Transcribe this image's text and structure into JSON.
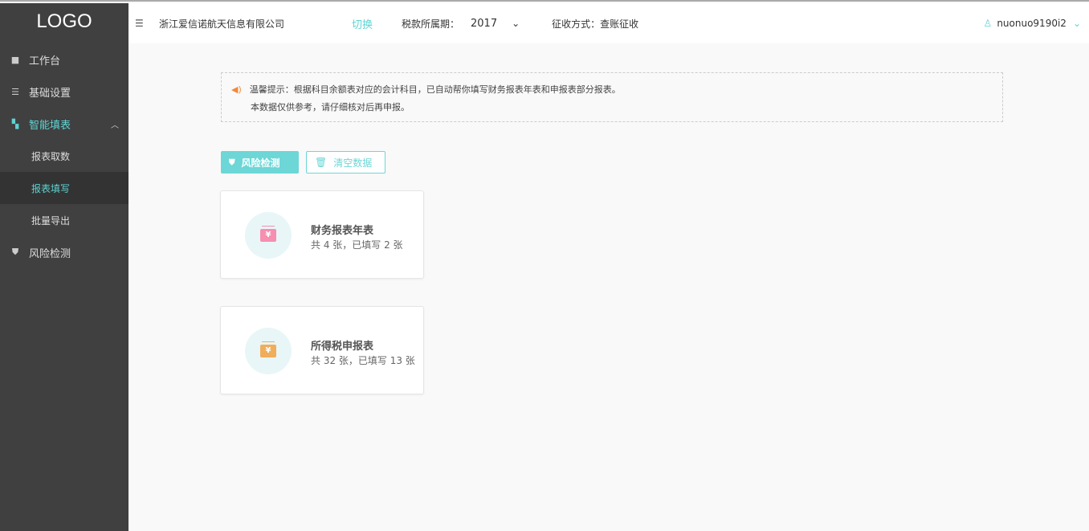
{
  "sidebar": {
    "logo": "LOGO",
    "items": [
      {
        "label": "工作台"
      },
      {
        "label": "基础设置"
      },
      {
        "label": "智能填表"
      },
      {
        "label": "报表取数"
      },
      {
        "label": "报表填写"
      },
      {
        "label": "批量导出"
      },
      {
        "label": "风险检测"
      }
    ]
  },
  "header": {
    "company": "浙江爱信诺航天信息有限公司",
    "switch": "切换",
    "period_label": "税款所属期：",
    "period_value": "2017",
    "collect": "征收方式：查账征收",
    "user": "nuonuo9190i2"
  },
  "notice": {
    "line1": "温馨提示：根据科目余额表对应的会计科目，已自动帮你填写财务报表年表和申报表部分报表。",
    "line2": "本数据仅供参考，请仔细核对后再申报。"
  },
  "actions": {
    "risk": "风险检测",
    "clear": "清空数据"
  },
  "cards": [
    {
      "title": "财务报表年表",
      "summary": "共 4 张，已填写 2 张",
      "color": "#f68fb0"
    },
    {
      "title": "所得税申报表",
      "summary": "共 32 张，已填写 13 张",
      "color": "#f0ad5c"
    }
  ],
  "colors": {
    "accent": "#6dd6d6",
    "sidebar": "#404040"
  }
}
